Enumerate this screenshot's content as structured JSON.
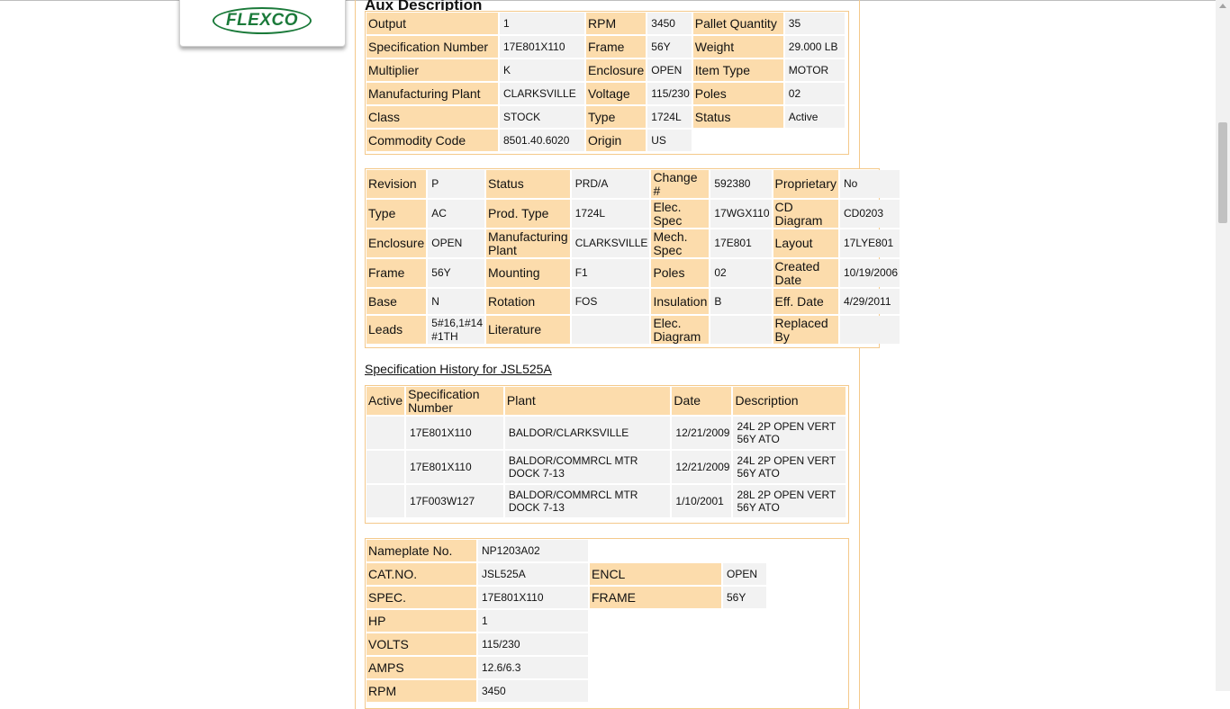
{
  "logo": {
    "brand": "FLEXCO"
  },
  "aux": {
    "title": "Aux Description",
    "rows": [
      [
        "Output",
        "1",
        "RPM",
        "3450",
        "Pallet Quantity",
        "35"
      ],
      [
        "Specification Number",
        "17E801X110",
        "Frame",
        "56Y",
        "Weight",
        "29.000 LB"
      ],
      [
        "Multiplier",
        "K",
        "Enclosure",
        "OPEN",
        "Item Type",
        "MOTOR"
      ],
      [
        "Manufacturing Plant",
        "CLARKSVILLE",
        "Voltage",
        "115/230",
        "Poles",
        "02"
      ],
      [
        "Class",
        "STOCK",
        "Type",
        "1724L",
        "Status",
        "Active"
      ],
      [
        "Commodity Code",
        "8501.40.6020",
        "Origin",
        "US",
        "",
        ""
      ]
    ]
  },
  "spec": {
    "rows": [
      [
        "Revision",
        "P",
        "Status",
        "PRD/A",
        "Change #",
        "592380",
        "Proprietary",
        "No"
      ],
      [
        "Type",
        "AC",
        "Prod. Type",
        "1724L",
        "Elec. Spec",
        "17WGX110",
        "CD Diagram",
        "CD0203"
      ],
      [
        "Enclosure",
        "OPEN",
        "Manufacturing Plant",
        "CLARKSVILLE",
        "Mech. Spec",
        "17E801",
        "Layout",
        "17LYE801"
      ],
      [
        "Frame",
        "56Y",
        "Mounting",
        "F1",
        "Poles",
        "02",
        "Created Date",
        "10/19/2006"
      ],
      [
        "Base",
        "N",
        "Rotation",
        "FOS",
        "Insulation",
        "B",
        "Eff. Date",
        "4/29/2011"
      ],
      [
        "Leads",
        "5#16,1#14 #1TH",
        "Literature",
        "",
        "Elec. Diagram",
        "",
        "Replaced By",
        ""
      ]
    ]
  },
  "history": {
    "title": "Specification History for JSL525A",
    "headers": [
      "Active",
      "Specification Number",
      "Plant",
      "Date",
      "Description"
    ],
    "rows": [
      [
        "",
        "17E801X110",
        "BALDOR/CLARKSVILLE",
        "12/21/2009",
        "24L 2P OPEN VERT 56Y ATO"
      ],
      [
        "",
        "17E801X110",
        "BALDOR/COMMRCL MTR DOCK 7-13",
        "12/21/2009",
        "24L 2P OPEN VERT 56Y ATO"
      ],
      [
        "",
        "17F003W127",
        "BALDOR/COMMRCL MTR DOCK 7-13",
        "1/10/2001",
        "28L 2P OPEN VERT 56Y ATO"
      ]
    ]
  },
  "nameplate": {
    "rows": [
      [
        "Nameplate No.",
        "NP1203A02",
        "",
        ""
      ],
      [
        "CAT.NO.",
        "JSL525A",
        "ENCL",
        "OPEN"
      ],
      [
        "SPEC.",
        "17E801X110",
        "FRAME",
        "56Y"
      ],
      [
        "HP",
        "1",
        "",
        ""
      ],
      [
        "VOLTS",
        "115/230",
        "",
        ""
      ],
      [
        "AMPS",
        "12.6/6.3",
        "",
        ""
      ],
      [
        "RPM",
        "3450",
        "",
        ""
      ]
    ]
  }
}
